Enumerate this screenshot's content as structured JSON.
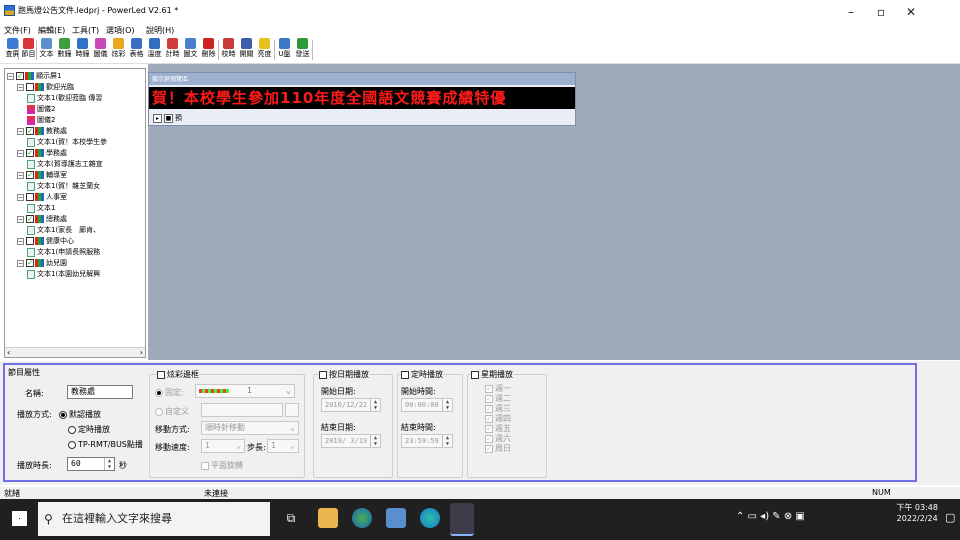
{
  "window": {
    "title": "跑馬燈公告文件.ledprj - PowerLed V2.61 *",
    "min": "–",
    "max": "▫",
    "close": "✕"
  },
  "menu": [
    "文件(F)",
    "編輯(E)",
    "工具(T)",
    "選項(O)",
    "說明(H)"
  ],
  "toolbar": [
    {
      "label": "查屏",
      "color": "#3b7bd6"
    },
    {
      "label": "節目",
      "color": "#d9323a"
    },
    {
      "label": "文本",
      "color": "#5a8fd0"
    },
    {
      "label": "數鐘",
      "color": "#3e9e3e"
    },
    {
      "label": "時鐘",
      "color": "#2e72c8"
    },
    {
      "label": "圖儀",
      "color": "#c84ab8"
    },
    {
      "label": "炫彩",
      "color": "#e6a81c"
    },
    {
      "label": "表格",
      "color": "#3a6fc4"
    },
    {
      "label": "溫度",
      "color": "#2f6fbd"
    },
    {
      "label": "計時",
      "color": "#d03c3c"
    },
    {
      "label": "圖文",
      "color": "#4a7fcf"
    },
    {
      "label": "刪除",
      "color": "#c22"
    },
    {
      "label": "校時",
      "color": "#c93a3a"
    },
    {
      "label": "開關",
      "color": "#3d5fa8"
    },
    {
      "label": "亮度",
      "color": "#e5c21e"
    },
    {
      "label": "U盤",
      "color": "#3c78c8"
    },
    {
      "label": "發送",
      "color": "#2e9a3a"
    }
  ],
  "tree": [
    {
      "label": "顯示屏1",
      "level": 0,
      "type": "screen",
      "checked": true,
      "expand": "⊟"
    },
    {
      "label": "歡迎光臨",
      "level": 1,
      "type": "program",
      "checked": false,
      "expand": "⊟"
    },
    {
      "label": "文本1(歡迎蒞臨 傳習",
      "level": 2,
      "type": "text"
    },
    {
      "label": "圖儀2",
      "level": 2,
      "type": "image"
    },
    {
      "label": "圖儀2",
      "level": 2,
      "type": "image"
    },
    {
      "label": "教務處",
      "level": 1,
      "type": "program",
      "checked": true,
      "expand": "⊟"
    },
    {
      "label": "文本1(賀！本校學生參",
      "level": 2,
      "type": "text"
    },
    {
      "label": "學務處",
      "level": 1,
      "type": "program",
      "checked": true,
      "expand": "⊟"
    },
    {
      "label": "文本(賀導護志工雜宣",
      "level": 2,
      "type": "text"
    },
    {
      "label": "輔導室",
      "level": 1,
      "type": "program",
      "checked": true,
      "expand": "⊟"
    },
    {
      "label": "文本1(賀！雜芝蘭女",
      "level": 2,
      "type": "text"
    },
    {
      "label": "人事室",
      "level": 1,
      "type": "program",
      "checked": false,
      "expand": "⊟"
    },
    {
      "label": "文本1",
      "level": 2,
      "type": "text"
    },
    {
      "label": "總務處",
      "level": 1,
      "type": "program",
      "checked": true,
      "expand": "⊟"
    },
    {
      "label": "文本1(家長　廊肯、",
      "level": 2,
      "type": "text"
    },
    {
      "label": "健康中心",
      "level": 1,
      "type": "program",
      "checked": false,
      "expand": "⊟"
    },
    {
      "label": "文本1(申請長照服務",
      "level": 2,
      "type": "text"
    },
    {
      "label": "幼兒園",
      "level": 1,
      "type": "program",
      "checked": true,
      "expand": "⊟"
    },
    {
      "label": "文本1(本園幼兒解興",
      "level": 2,
      "type": "text"
    }
  ],
  "preview": {
    "caption": "顯示屏預覽區",
    "text": "賀！本校學生參加110年度全國語文競賽成績特優",
    "button": "預"
  },
  "props": {
    "section_title": "節目屬性",
    "name_label": "名稱:",
    "name_value": "教務處",
    "mode_label": "播放方式:",
    "mode_default": "默認播放",
    "mode_timed": "定時播放",
    "mode_tp": "TP-RMT/BUS點播",
    "duration_label": "播放時長:",
    "duration_value": "60",
    "duration_unit": "秒",
    "border_check": "炫彩邊框",
    "fixed_label": "固定:",
    "fixed_num": "1",
    "custom_label": "自定义",
    "move_label": "移動方式:",
    "move_value": "順時針移動",
    "speed_label": "移動速度:",
    "speed_value": "1",
    "step_label": "步長:",
    "step_value": "1",
    "flat_label": "平面旋轉",
    "date_check": "按日期播放",
    "start_date_label": "開始日期:",
    "start_date": "2010/12/22",
    "end_date_label": "結束日期:",
    "end_date": "2019/ 3/19",
    "time_check": "定時播放",
    "start_time_label": "開始時間:",
    "start_time": "00:00:00",
    "end_time_label": "結束時間:",
    "end_time": "23:59:59",
    "week_check": "星期播放",
    "weekdays": [
      "週一",
      "週二",
      "週三",
      "週四",
      "週五",
      "週六",
      "周日"
    ]
  },
  "status": {
    "left": "就緒",
    "middle": "未連接",
    "right": "NUM"
  },
  "taskbar": {
    "search_placeholder": "在這裡輸入文字來搜尋",
    "time": "下午 03:48",
    "date": "2022/2/24"
  }
}
